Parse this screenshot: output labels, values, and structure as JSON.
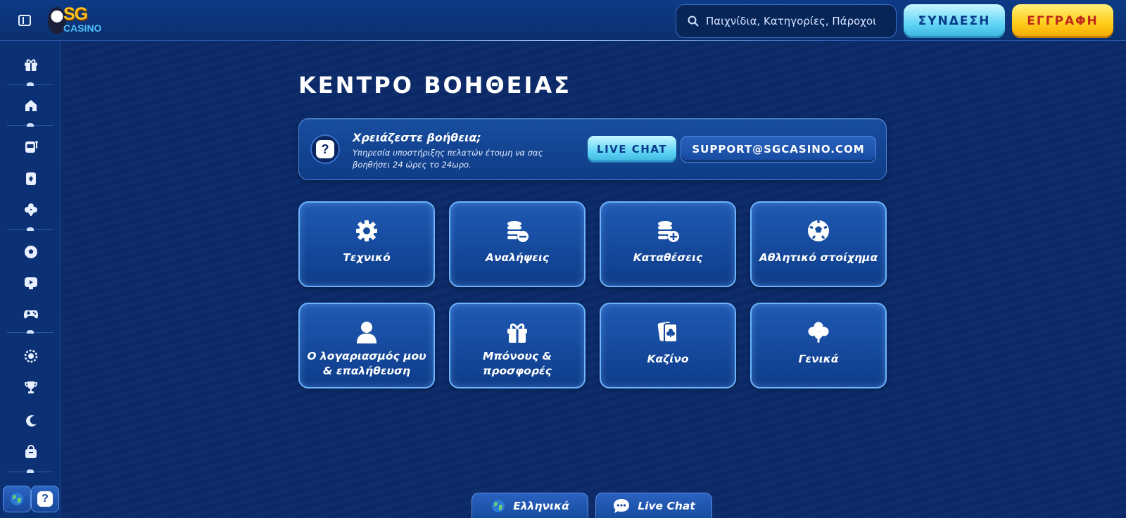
{
  "header": {
    "logo_sg": "SG",
    "logo_casino": "CASINO",
    "search_placeholder": "Παιχνίδια, Κατηγορίες, Πάροχοι",
    "login_label": "ΣΥΝΔΕΣΗ",
    "register_label": "ΕΓΓΡΑΦΗ"
  },
  "sidebar": {
    "items": [
      {
        "icon": "gift-icon"
      },
      {
        "icon": "home-icon"
      },
      {
        "icon": "slot-machine-icon"
      },
      {
        "icon": "playing-card-icon"
      },
      {
        "icon": "clover-icon"
      },
      {
        "icon": "soccer-ball-icon"
      },
      {
        "icon": "play-tv-icon"
      },
      {
        "icon": "gamepad-icon"
      },
      {
        "icon": "badge-icon"
      },
      {
        "icon": "trophy-icon"
      },
      {
        "icon": "moon-icon"
      },
      {
        "icon": "shop-bag-icon"
      }
    ],
    "bottom": [
      {
        "icon": "globe-icon"
      },
      {
        "icon": "help-icon"
      }
    ]
  },
  "main": {
    "title": "ΚΕΝΤΡΟ ΒΟΗΘΕΙΑΣ",
    "banner": {
      "title": "Χρειάζεστε βοήθεια;",
      "subtitle": "Υπηρεσία υποστήριξης πελατών έτοιμη να σας βοηθήσει 24 ώρες το 24ωρο.",
      "live_chat_label": "LIVE CHAT",
      "email_label": "SUPPORT@SGCASINO.COM"
    },
    "cards": [
      {
        "label": "Τεχνικό",
        "icon": "gear-icon"
      },
      {
        "label": "Αναλήψεις",
        "icon": "coins-minus-icon"
      },
      {
        "label": "Καταθέσεις",
        "icon": "coins-plus-icon"
      },
      {
        "label": "Αθλητικό στοίχημα",
        "icon": "soccer-ball-icon"
      },
      {
        "label": "Ο λογαριασμός μου & επαλήθευση",
        "icon": "user-icon"
      },
      {
        "label": "Μπόνους & προσφορές",
        "icon": "gift-icon"
      },
      {
        "label": "Καζίνο",
        "icon": "playing-cards-icon"
      },
      {
        "label": "Γενικά",
        "icon": "clover-icon"
      }
    ]
  },
  "footer": {
    "language_label": "Ελληνικά",
    "chat_label": "Live Chat"
  },
  "colors": {
    "background": "#0a2a68",
    "accent_cyan": "#5fd4f5",
    "accent_yellow": "#ffce1c",
    "register_text": "#c0261a"
  }
}
